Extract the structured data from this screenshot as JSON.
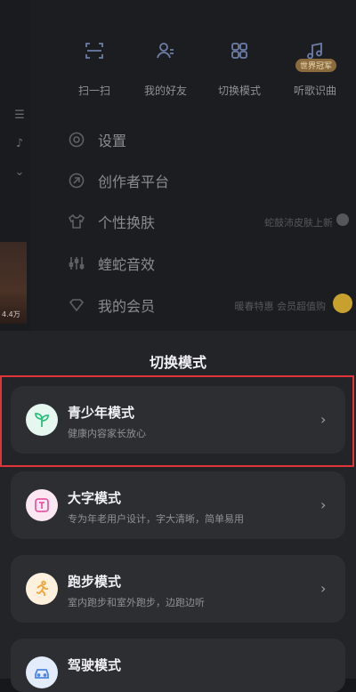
{
  "shortcuts": [
    {
      "label": "扫一扫",
      "icon": "scan-icon"
    },
    {
      "label": "我的好友",
      "icon": "friends-icon"
    },
    {
      "label": "切换模式",
      "icon": "switch-mode-icon"
    },
    {
      "label": "听歌识曲",
      "icon": "music-recognition-icon",
      "badge": "世界冠军"
    }
  ],
  "menu": [
    {
      "label": "设置",
      "icon": "settings-icon",
      "right": ""
    },
    {
      "label": "创作者平台",
      "icon": "creator-icon",
      "right": ""
    },
    {
      "label": "个性换肤",
      "icon": "skin-icon",
      "right": "蛇鼓沛皮肤上新"
    },
    {
      "label": "蝰蛇音效",
      "icon": "equalizer-icon",
      "right": ""
    },
    {
      "label": "我的会员",
      "icon": "vip-icon",
      "right": "暖春特惠 会员超值购"
    }
  ],
  "left_strip": {
    "count": "4.4万"
  },
  "sheet": {
    "title": "切换模式",
    "modes": [
      {
        "title": "青少年模式",
        "desc": "健康内容家长放心",
        "icon": "sprout-icon",
        "color": "#3ecf8e"
      },
      {
        "title": "大字模式",
        "desc": "专为年老用户设计，字大清晰，简单易用",
        "icon": "text-icon",
        "color": "#e85aa5"
      },
      {
        "title": "跑步模式",
        "desc": "室内跑步和室外跑步，边跑边听",
        "icon": "runner-icon",
        "color": "#f2a33a"
      },
      {
        "title": "驾驶模式",
        "desc": "",
        "icon": "car-icon",
        "color": "#4f86e6"
      }
    ]
  },
  "colors": {
    "highlight": "#e0333a",
    "accent": "#6c7ea8"
  }
}
